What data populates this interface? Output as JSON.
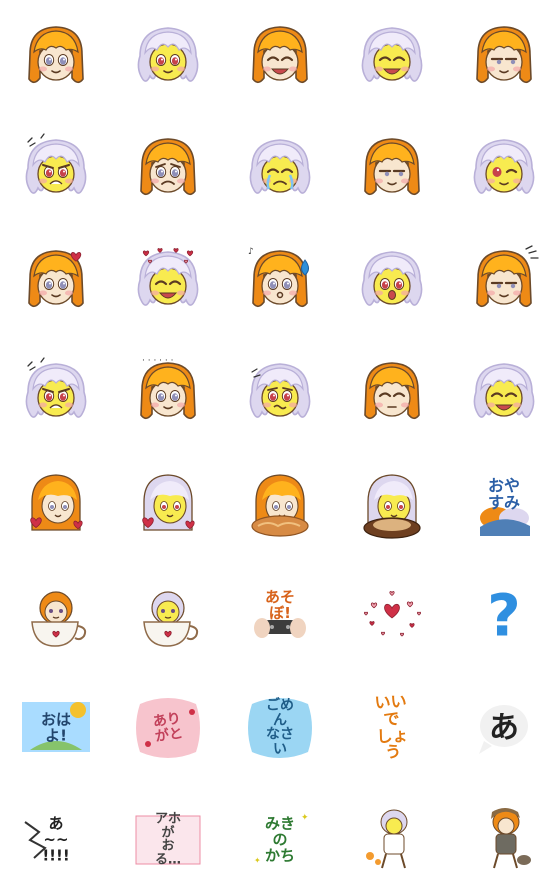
{
  "colors": {
    "orange_hair": "#ee8a16",
    "orange_hair_light": "#ffb21d",
    "lavender_hair": "#ddd7ef",
    "lavender_shadow": "#b9b0d8",
    "yellow_face": "#f8eb50",
    "skin": "#f8e6cf",
    "outline": "#6c4a2a",
    "heart": "#cf3047",
    "pink": "#f2a7b4",
    "blue": "#2d8fd9",
    "sky": "#9bd6f3"
  },
  "stickers": [
    {
      "kind": "face",
      "char": "orange",
      "expression": "neutral"
    },
    {
      "kind": "face",
      "char": "lavender",
      "expression": "neutral"
    },
    {
      "kind": "face",
      "char": "orange",
      "expression": "laugh"
    },
    {
      "kind": "face",
      "char": "lavender",
      "expression": "happy"
    },
    {
      "kind": "face",
      "char": "orange",
      "expression": "sideeye"
    },
    {
      "kind": "face",
      "char": "lavender",
      "expression": "angry"
    },
    {
      "kind": "face",
      "char": "orange",
      "expression": "sad"
    },
    {
      "kind": "face",
      "char": "lavender",
      "expression": "cry"
    },
    {
      "kind": "face",
      "char": "orange",
      "expression": "tired"
    },
    {
      "kind": "face",
      "char": "lavender",
      "expression": "wink"
    },
    {
      "kind": "face",
      "char": "orange",
      "expression": "heart"
    },
    {
      "kind": "face",
      "char": "lavender",
      "expression": "hearts"
    },
    {
      "kind": "face",
      "char": "orange",
      "expression": "whistle"
    },
    {
      "kind": "face",
      "char": "lavender",
      "expression": "surprised"
    },
    {
      "kind": "face",
      "char": "orange",
      "expression": "annoyed"
    },
    {
      "kind": "face",
      "char": "lavender",
      "expression": "angry"
    },
    {
      "kind": "face",
      "char": "orange",
      "expression": "dots"
    },
    {
      "kind": "face",
      "char": "lavender",
      "expression": "worried"
    },
    {
      "kind": "face",
      "char": "orange",
      "expression": "sleepy"
    },
    {
      "kind": "face",
      "char": "lavender",
      "expression": "laugh"
    },
    {
      "kind": "body",
      "char": "orange",
      "prop": "heart"
    },
    {
      "kind": "body",
      "char": "lavender",
      "prop": "heart"
    },
    {
      "kind": "body",
      "char": "orange",
      "prop": "bread"
    },
    {
      "kind": "body",
      "char": "lavender",
      "prop": "donut"
    },
    {
      "kind": "text",
      "text": "おやすみ",
      "style": "oyasumi",
      "color": "#2b5fa7"
    },
    {
      "kind": "cup",
      "char": "orange"
    },
    {
      "kind": "cup",
      "char": "lavender"
    },
    {
      "kind": "text",
      "text": "あそぼ!",
      "style": "asobo",
      "color": "#d8631b"
    },
    {
      "kind": "hearts"
    },
    {
      "kind": "question",
      "text": "?",
      "color": "#2f8fe0"
    },
    {
      "kind": "text",
      "text": "おはよ!",
      "style": "ohayo",
      "color": "#22456c"
    },
    {
      "kind": "text",
      "text": "ありがと",
      "style": "arigato",
      "color": "#c2415b"
    },
    {
      "kind": "text",
      "text": "ごめん\nなさい",
      "style": "gomen",
      "color": "#1f5d88"
    },
    {
      "kind": "text",
      "text": "いいで\nしょう",
      "style": "iide",
      "color": "#e37a10"
    },
    {
      "kind": "text",
      "text": "あ",
      "style": "a-bubble",
      "color": "#222222"
    },
    {
      "kind": "text",
      "text": "あ~~\n!!!!",
      "style": "a-shock",
      "color": "#222222"
    },
    {
      "kind": "text",
      "text": "アホが\nおる…",
      "style": "aho",
      "color": "#444444"
    },
    {
      "kind": "text",
      "text": "みきの\nかち",
      "style": "miki",
      "color": "#2e7a32"
    },
    {
      "kind": "mini",
      "char": "lavender"
    },
    {
      "kind": "mini",
      "char": "orange"
    }
  ]
}
